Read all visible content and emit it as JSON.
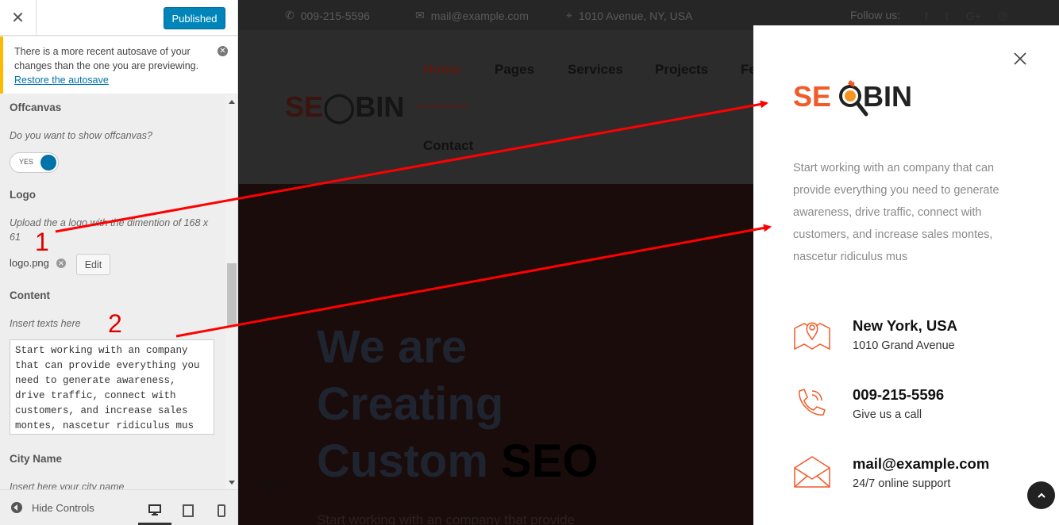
{
  "sidebar": {
    "publish_label": "Published",
    "notice": {
      "text": "There is a more recent autosave of your changes than the one you are previewing.",
      "link": "Restore the autosave"
    },
    "offcanvas": {
      "title": "Offcanvas",
      "question": "Do you want to show offcanvas?",
      "toggle_label": "YES",
      "toggle_on": true
    },
    "logo": {
      "title": "Logo",
      "desc": "Upload the a logo with the dimention of 168 x 61",
      "file": "logo.png",
      "edit_label": "Edit"
    },
    "content": {
      "title": "Content",
      "desc": "Insert texts here",
      "value": "Start working with an company that can provide everything you need to generate awareness, drive traffic, connect with customers, and increase sales montes, nascetur ridiculus mus"
    },
    "city": {
      "title": "City Name",
      "desc": "Insert here your city name"
    },
    "footer": {
      "hide_label": "Hide Controls"
    }
  },
  "preview": {
    "topbar": {
      "phone": "009-215-5596",
      "email": "mail@example.com",
      "address": "1010 Avenue, NY, USA",
      "follow": "Follow us:"
    },
    "nav": [
      "Home",
      "Pages",
      "Services",
      "Projects",
      "Fe",
      "Contact"
    ],
    "hero": {
      "line1": "We are",
      "line2": "Creating",
      "line3a": "Custom",
      "line3b": "SEO",
      "sub": "Start working with an company that provide"
    }
  },
  "offcanvas_panel": {
    "logo_a": "SE",
    "logo_b": "BIN",
    "text": "Start working with an company that can provide everything you need to generate awareness, drive traffic, connect with customers, and increase sales montes, nascetur ridiculus mus",
    "items": [
      {
        "heading": "New York, USA",
        "sub": "1010 Grand Avenue",
        "icon": "map-pin-icon"
      },
      {
        "heading": "009-215-5596",
        "sub": "Give us a call",
        "icon": "phone-icon"
      },
      {
        "heading": "mail@example.com",
        "sub": "24/7 online support",
        "icon": "envelope-icon"
      }
    ]
  },
  "annotations": {
    "one": "1",
    "two": "2"
  },
  "colors": {
    "accent": "#f15a29",
    "wp_blue": "#0085ba",
    "notice": "#ffb900",
    "arrow": "#ff0000"
  }
}
